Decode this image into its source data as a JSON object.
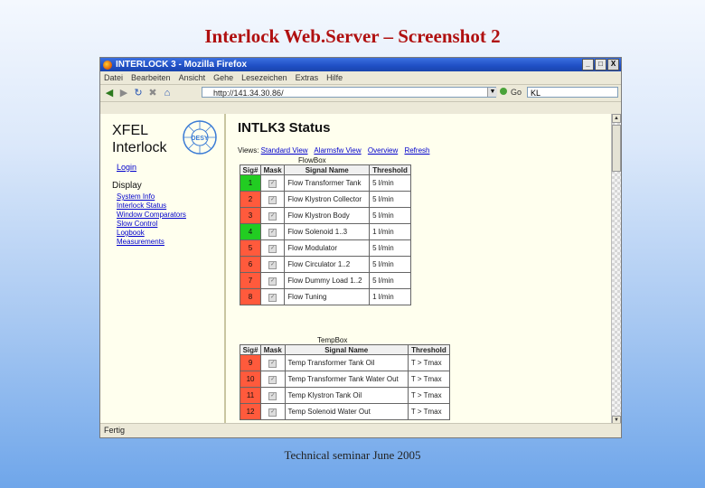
{
  "slide": {
    "title": "Interlock Web.Server – Screenshot 2",
    "footer": "Technical seminar June 2005"
  },
  "window": {
    "title": "INTERLOCK 3 - Mozilla Firefox",
    "controls": {
      "minimize": "_",
      "maximize": "□",
      "close": "X"
    }
  },
  "menu": [
    "Datei",
    "Bearbeiten",
    "Ansicht",
    "Gehe",
    "Lesezeichen",
    "Extras",
    "Hilfe"
  ],
  "navbar": {
    "url": "http://141.34.30.86/",
    "go_label": "Go",
    "search_value": "KL"
  },
  "sidebar": {
    "app_title_line1": "XFEL",
    "app_title_line2": "Interlock",
    "logo_text": "DESY",
    "login": "Login",
    "display_heading": "Display",
    "items": [
      "System Info",
      "Interlock Status",
      "Window Comparators",
      "Slow Control",
      "Logbook",
      "Measurements"
    ]
  },
  "main": {
    "title": "INTLK3 Status",
    "views_label": "Views:",
    "views": [
      "Standard View",
      "Alarmsfw View",
      "Overview",
      "Refresh"
    ],
    "groups": [
      {
        "label": "FlowBox",
        "headers": [
          "Sig#",
          "Mask",
          "Signal Name",
          "Threshold"
        ],
        "rows": [
          {
            "sig": "1",
            "status": "green",
            "name": "Flow Transformer Tank",
            "threshold": "5 l/min"
          },
          {
            "sig": "2",
            "status": "red",
            "name": "Flow Klystron Collector",
            "threshold": "5 l/min"
          },
          {
            "sig": "3",
            "status": "red",
            "name": "Flow Klystron Body",
            "threshold": "5 l/min"
          },
          {
            "sig": "4",
            "status": "green",
            "name": "Flow Solenoid 1..3",
            "threshold": "1 l/min"
          },
          {
            "sig": "5",
            "status": "red",
            "name": "Flow Modulator",
            "threshold": "5 l/min"
          },
          {
            "sig": "6",
            "status": "red",
            "name": "Flow Circulator 1..2",
            "threshold": "5 l/min"
          },
          {
            "sig": "7",
            "status": "red",
            "name": "Flow Dummy Load 1..2",
            "threshold": "5 l/min"
          },
          {
            "sig": "8",
            "status": "red",
            "name": "Flow Tuning",
            "threshold": "1 l/min"
          }
        ]
      },
      {
        "label": "TempBox",
        "headers": [
          "Sig#",
          "Mask",
          "Signal Name",
          "Threshold"
        ],
        "rows": [
          {
            "sig": "9",
            "status": "red",
            "name": "Temp Transformer Tank Oil",
            "threshold": "T > Tmax"
          },
          {
            "sig": "10",
            "status": "red",
            "name": "Temp Transformer Tank Water Out",
            "threshold": "T > Tmax"
          },
          {
            "sig": "11",
            "status": "red",
            "name": "Temp Klystron Tank Oil",
            "threshold": "T > Tmax"
          },
          {
            "sig": "12",
            "status": "red",
            "name": "Temp Solenoid Water Out",
            "threshold": "T > Tmax"
          }
        ]
      }
    ]
  },
  "statusbar": {
    "text": "Fertig"
  },
  "colors": {
    "status_green": "#22cc22",
    "status_red": "#ff5a3c",
    "title_red": "#b01010",
    "link_blue": "#0000cc"
  }
}
